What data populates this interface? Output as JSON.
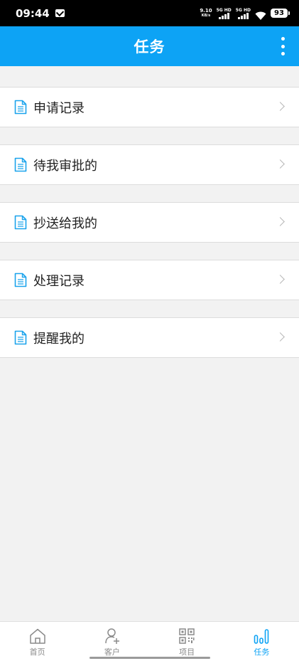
{
  "status_bar": {
    "time": "09:44",
    "net_speed_value": "9.10",
    "net_speed_unit": "KB/s",
    "sim1_label": "5G HD",
    "sim2_label": "5G HD",
    "battery": "93"
  },
  "app_bar": {
    "title": "任务"
  },
  "menu_items": [
    {
      "label": "申请记录"
    },
    {
      "label": "待我审批的"
    },
    {
      "label": "抄送给我的"
    },
    {
      "label": "处理记录"
    },
    {
      "label": "提醒我的"
    }
  ],
  "tabs": [
    {
      "label": "首页",
      "icon": "home-icon",
      "active": false
    },
    {
      "label": "客户",
      "icon": "add-user-icon",
      "active": false
    },
    {
      "label": "项目",
      "icon": "qr-code-icon",
      "active": false
    },
    {
      "label": "任务",
      "icon": "task-chart-icon",
      "active": true
    }
  ],
  "colors": {
    "primary": "#0da3f5",
    "background": "#f2f2f2",
    "inactive_tab": "#8a8a8a"
  }
}
